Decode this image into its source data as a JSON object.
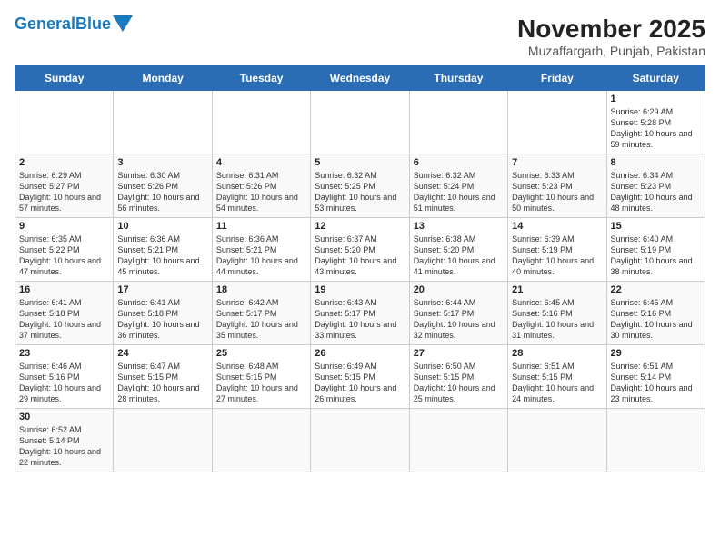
{
  "header": {
    "logo_general": "General",
    "logo_blue": "Blue",
    "title": "November 2025",
    "subtitle": "Muzaffargarh, Punjab, Pakistan"
  },
  "days_of_week": [
    "Sunday",
    "Monday",
    "Tuesday",
    "Wednesday",
    "Thursday",
    "Friday",
    "Saturday"
  ],
  "weeks": [
    [
      {
        "day": "",
        "sunrise": "",
        "sunset": "",
        "daylight": ""
      },
      {
        "day": "",
        "sunrise": "",
        "sunset": "",
        "daylight": ""
      },
      {
        "day": "",
        "sunrise": "",
        "sunset": "",
        "daylight": ""
      },
      {
        "day": "",
        "sunrise": "",
        "sunset": "",
        "daylight": ""
      },
      {
        "day": "",
        "sunrise": "",
        "sunset": "",
        "daylight": ""
      },
      {
        "day": "",
        "sunrise": "",
        "sunset": "",
        "daylight": ""
      },
      {
        "day": "1",
        "sunrise": "Sunrise: 6:29 AM",
        "sunset": "Sunset: 5:28 PM",
        "daylight": "Daylight: 10 hours and 59 minutes."
      }
    ],
    [
      {
        "day": "2",
        "sunrise": "Sunrise: 6:29 AM",
        "sunset": "Sunset: 5:27 PM",
        "daylight": "Daylight: 10 hours and 57 minutes."
      },
      {
        "day": "3",
        "sunrise": "Sunrise: 6:30 AM",
        "sunset": "Sunset: 5:26 PM",
        "daylight": "Daylight: 10 hours and 56 minutes."
      },
      {
        "day": "4",
        "sunrise": "Sunrise: 6:31 AM",
        "sunset": "Sunset: 5:26 PM",
        "daylight": "Daylight: 10 hours and 54 minutes."
      },
      {
        "day": "5",
        "sunrise": "Sunrise: 6:32 AM",
        "sunset": "Sunset: 5:25 PM",
        "daylight": "Daylight: 10 hours and 53 minutes."
      },
      {
        "day": "6",
        "sunrise": "Sunrise: 6:32 AM",
        "sunset": "Sunset: 5:24 PM",
        "daylight": "Daylight: 10 hours and 51 minutes."
      },
      {
        "day": "7",
        "sunrise": "Sunrise: 6:33 AM",
        "sunset": "Sunset: 5:23 PM",
        "daylight": "Daylight: 10 hours and 50 minutes."
      },
      {
        "day": "8",
        "sunrise": "Sunrise: 6:34 AM",
        "sunset": "Sunset: 5:23 PM",
        "daylight": "Daylight: 10 hours and 48 minutes."
      }
    ],
    [
      {
        "day": "9",
        "sunrise": "Sunrise: 6:35 AM",
        "sunset": "Sunset: 5:22 PM",
        "daylight": "Daylight: 10 hours and 47 minutes."
      },
      {
        "day": "10",
        "sunrise": "Sunrise: 6:36 AM",
        "sunset": "Sunset: 5:21 PM",
        "daylight": "Daylight: 10 hours and 45 minutes."
      },
      {
        "day": "11",
        "sunrise": "Sunrise: 6:36 AM",
        "sunset": "Sunset: 5:21 PM",
        "daylight": "Daylight: 10 hours and 44 minutes."
      },
      {
        "day": "12",
        "sunrise": "Sunrise: 6:37 AM",
        "sunset": "Sunset: 5:20 PM",
        "daylight": "Daylight: 10 hours and 43 minutes."
      },
      {
        "day": "13",
        "sunrise": "Sunrise: 6:38 AM",
        "sunset": "Sunset: 5:20 PM",
        "daylight": "Daylight: 10 hours and 41 minutes."
      },
      {
        "day": "14",
        "sunrise": "Sunrise: 6:39 AM",
        "sunset": "Sunset: 5:19 PM",
        "daylight": "Daylight: 10 hours and 40 minutes."
      },
      {
        "day": "15",
        "sunrise": "Sunrise: 6:40 AM",
        "sunset": "Sunset: 5:19 PM",
        "daylight": "Daylight: 10 hours and 38 minutes."
      }
    ],
    [
      {
        "day": "16",
        "sunrise": "Sunrise: 6:41 AM",
        "sunset": "Sunset: 5:18 PM",
        "daylight": "Daylight: 10 hours and 37 minutes."
      },
      {
        "day": "17",
        "sunrise": "Sunrise: 6:41 AM",
        "sunset": "Sunset: 5:18 PM",
        "daylight": "Daylight: 10 hours and 36 minutes."
      },
      {
        "day": "18",
        "sunrise": "Sunrise: 6:42 AM",
        "sunset": "Sunset: 5:17 PM",
        "daylight": "Daylight: 10 hours and 35 minutes."
      },
      {
        "day": "19",
        "sunrise": "Sunrise: 6:43 AM",
        "sunset": "Sunset: 5:17 PM",
        "daylight": "Daylight: 10 hours and 33 minutes."
      },
      {
        "day": "20",
        "sunrise": "Sunrise: 6:44 AM",
        "sunset": "Sunset: 5:17 PM",
        "daylight": "Daylight: 10 hours and 32 minutes."
      },
      {
        "day": "21",
        "sunrise": "Sunrise: 6:45 AM",
        "sunset": "Sunset: 5:16 PM",
        "daylight": "Daylight: 10 hours and 31 minutes."
      },
      {
        "day": "22",
        "sunrise": "Sunrise: 6:46 AM",
        "sunset": "Sunset: 5:16 PM",
        "daylight": "Daylight: 10 hours and 30 minutes."
      }
    ],
    [
      {
        "day": "23",
        "sunrise": "Sunrise: 6:46 AM",
        "sunset": "Sunset: 5:16 PM",
        "daylight": "Daylight: 10 hours and 29 minutes."
      },
      {
        "day": "24",
        "sunrise": "Sunrise: 6:47 AM",
        "sunset": "Sunset: 5:15 PM",
        "daylight": "Daylight: 10 hours and 28 minutes."
      },
      {
        "day": "25",
        "sunrise": "Sunrise: 6:48 AM",
        "sunset": "Sunset: 5:15 PM",
        "daylight": "Daylight: 10 hours and 27 minutes."
      },
      {
        "day": "26",
        "sunrise": "Sunrise: 6:49 AM",
        "sunset": "Sunset: 5:15 PM",
        "daylight": "Daylight: 10 hours and 26 minutes."
      },
      {
        "day": "27",
        "sunrise": "Sunrise: 6:50 AM",
        "sunset": "Sunset: 5:15 PM",
        "daylight": "Daylight: 10 hours and 25 minutes."
      },
      {
        "day": "28",
        "sunrise": "Sunrise: 6:51 AM",
        "sunset": "Sunset: 5:15 PM",
        "daylight": "Daylight: 10 hours and 24 minutes."
      },
      {
        "day": "29",
        "sunrise": "Sunrise: 6:51 AM",
        "sunset": "Sunset: 5:14 PM",
        "daylight": "Daylight: 10 hours and 23 minutes."
      }
    ],
    [
      {
        "day": "30",
        "sunrise": "Sunrise: 6:52 AM",
        "sunset": "Sunset: 5:14 PM",
        "daylight": "Daylight: 10 hours and 22 minutes."
      },
      {
        "day": "",
        "sunrise": "",
        "sunset": "",
        "daylight": ""
      },
      {
        "day": "",
        "sunrise": "",
        "sunset": "",
        "daylight": ""
      },
      {
        "day": "",
        "sunrise": "",
        "sunset": "",
        "daylight": ""
      },
      {
        "day": "",
        "sunrise": "",
        "sunset": "",
        "daylight": ""
      },
      {
        "day": "",
        "sunrise": "",
        "sunset": "",
        "daylight": ""
      },
      {
        "day": "",
        "sunrise": "",
        "sunset": "",
        "daylight": ""
      }
    ]
  ]
}
